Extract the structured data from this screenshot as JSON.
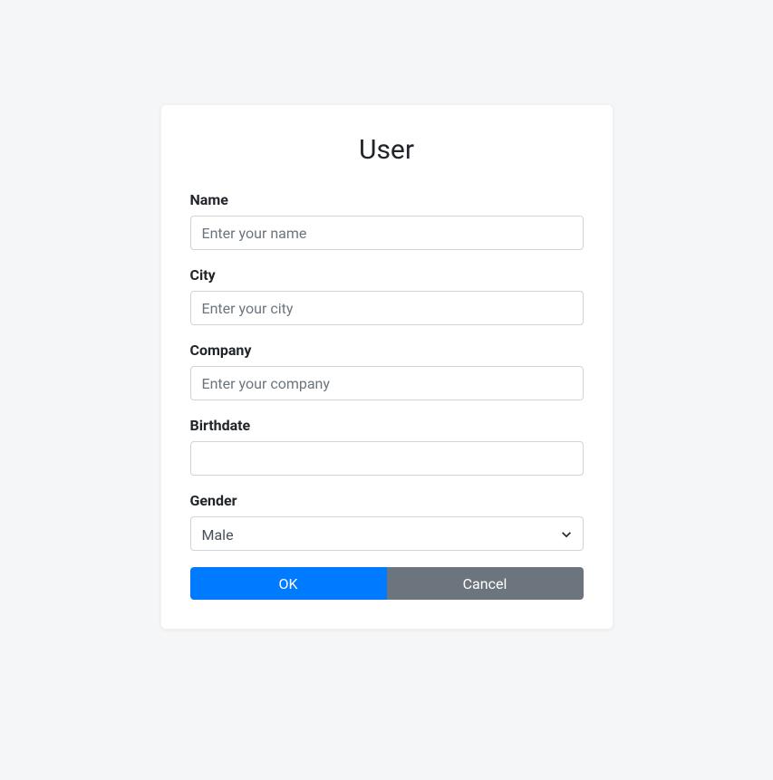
{
  "card": {
    "title": "User"
  },
  "form": {
    "name": {
      "label": "Name",
      "placeholder": "Enter your name",
      "value": ""
    },
    "city": {
      "label": "City",
      "placeholder": "Enter your city",
      "value": ""
    },
    "company": {
      "label": "Company",
      "placeholder": "Enter your company",
      "value": ""
    },
    "birthdate": {
      "label": "Birthdate",
      "value": ""
    },
    "gender": {
      "label": "Gender",
      "value": "Male",
      "options": [
        "Male"
      ]
    }
  },
  "buttons": {
    "ok": "OK",
    "cancel": "Cancel"
  }
}
